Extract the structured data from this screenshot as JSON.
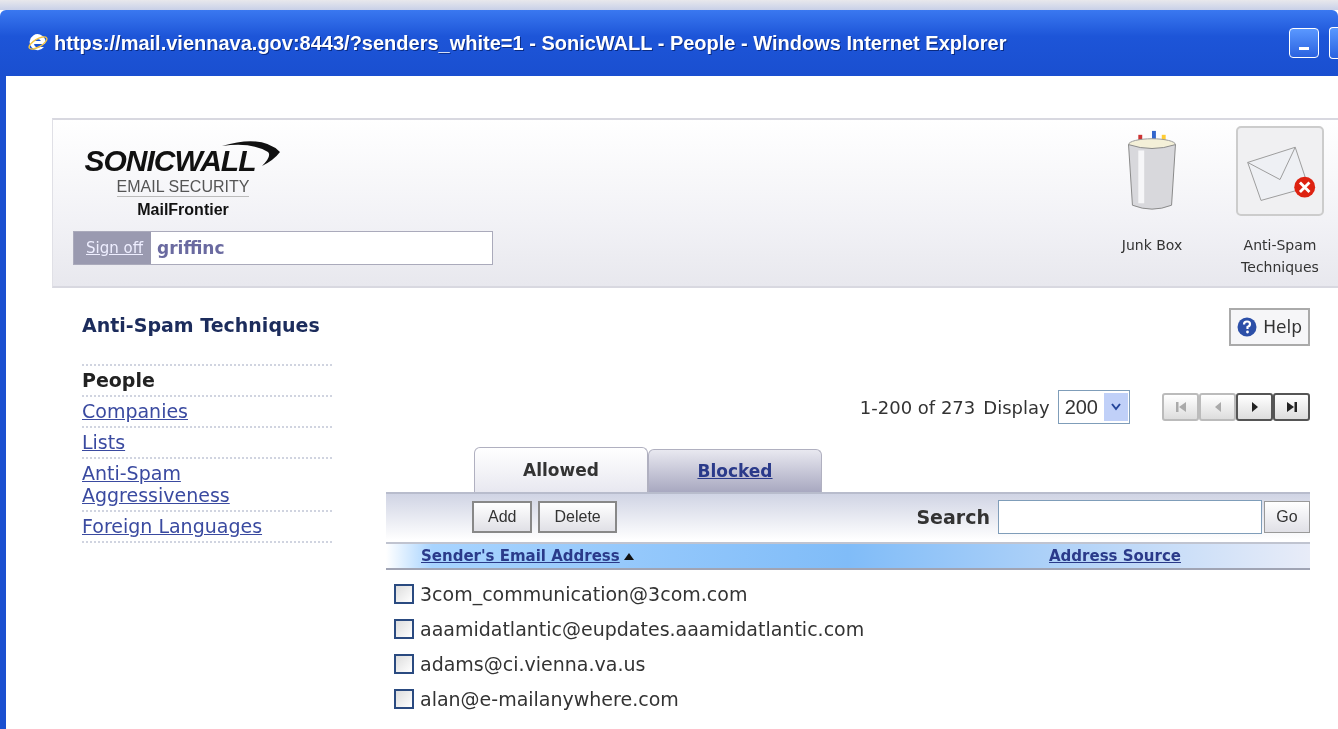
{
  "window": {
    "title": "https://mail.viennava.gov:8443/?senders_white=1 - SonicWALL - People - Windows Internet Explorer"
  },
  "header": {
    "logo": {
      "brand": "SONICWALL",
      "product": "EMAIL SECURITY",
      "sub": "MailFrontier"
    },
    "sign_off": "Sign off",
    "user": "griffinc",
    "nav": [
      {
        "kind": "trash",
        "label": "Junk Box",
        "selected": false
      },
      {
        "kind": "envelope",
        "label": "Anti-Spam Techniques",
        "selected": true
      }
    ]
  },
  "sidebar": {
    "title": "Anti-Spam Techniques",
    "items": [
      {
        "label": "People",
        "selected": true
      },
      {
        "label": "Companies",
        "selected": false
      },
      {
        "label": "Lists",
        "selected": false
      },
      {
        "label": "Anti-Spam Aggressiveness",
        "selected": false
      },
      {
        "label": "Foreign Languages",
        "selected": false
      }
    ]
  },
  "help": "Help",
  "pager": {
    "range": "1-200 of 273",
    "display_label": "Display",
    "display_value": "200",
    "buttons": [
      {
        "kind": "first",
        "disabled": true
      },
      {
        "kind": "prev",
        "disabled": true
      },
      {
        "kind": "next",
        "disabled": false
      },
      {
        "kind": "last",
        "disabled": false
      }
    ]
  },
  "tabs": [
    {
      "label": "Allowed",
      "selected": true
    },
    {
      "label": "Blocked",
      "selected": false
    }
  ],
  "toolbar": {
    "buttons": [
      "Add",
      "Delete"
    ],
    "search_label": "Search",
    "go": "Go"
  },
  "table": {
    "columns": [
      {
        "label": "Sender's Email Address",
        "sorted": true
      },
      {
        "label": "Address Source",
        "sorted": false
      }
    ],
    "rows": [
      {
        "email": "3com_communication@3com.com",
        "checked": false
      },
      {
        "email": "aaamidatlantic@eupdates.aaamidatlantic.com",
        "checked": false
      },
      {
        "email": "adams@ci.vienna.va.us",
        "checked": false
      },
      {
        "email": "alan@e-mailanywhere.com",
        "checked": false
      }
    ]
  }
}
